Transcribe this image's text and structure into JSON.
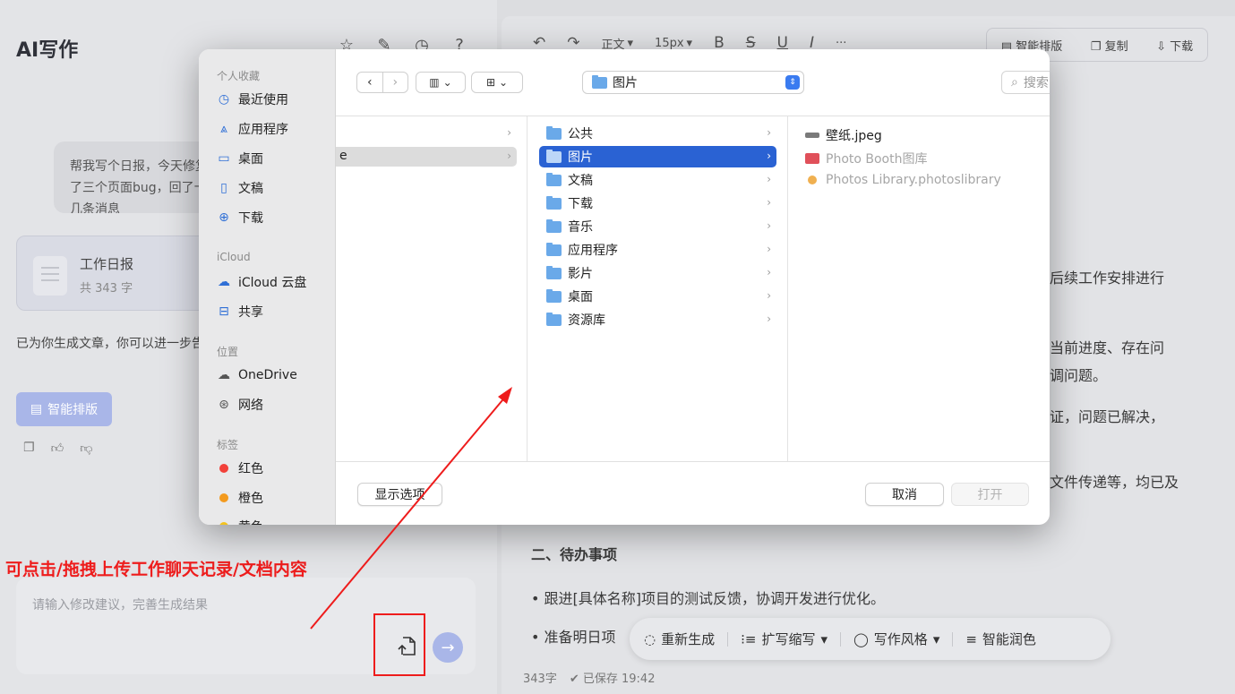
{
  "app": {
    "title": "AI写作",
    "prompt_text": "帮我写个日报，今天修复了三个页面bug，回了十几条消息",
    "doc_card": {
      "title": "工作日报",
      "count": "共 343 字"
    },
    "result_text": "已为你生成文章，你可以进一步告诉我改进的方向。",
    "smart_format_label": "智能排版",
    "annotation": "可点击/拖拽上传工作聊天记录/文档内容",
    "input_placeholder": "请输入修改建议，完善生成结果"
  },
  "editor": {
    "toolbar": {
      "style": "正文",
      "size": "15px",
      "bold": "B",
      "strike": "S",
      "underline": "U",
      "italic": "I",
      "more": "···"
    },
    "actions": {
      "smart_format": "智能排版",
      "copy": "复制",
      "download": "下载"
    },
    "fragments": [
      "后续工作安排进行",
      "当前进度、存在问",
      "调问题。",
      "证，问题已解决，",
      "文件传递等，均已及"
    ],
    "section2": "二、待办事项",
    "bullets": [
      "• 跟进[具体名称]项目的测试反馈，协调开发进行优化。",
      "• 准备明日项"
    ],
    "float_bar": {
      "regen": "重新生成",
      "expand": "扩写缩写",
      "style": "写作风格",
      "polish": "智能润色"
    },
    "status": {
      "words": "343字",
      "saved": "已保存 19:42"
    }
  },
  "dialog": {
    "sidebar": {
      "favorites_title": "个人收藏",
      "favorites": [
        {
          "label": "最近使用",
          "icon": "clock-icon"
        },
        {
          "label": "应用程序",
          "icon": "apps-icon"
        },
        {
          "label": "桌面",
          "icon": "desktop-icon"
        },
        {
          "label": "文稿",
          "icon": "document-icon"
        },
        {
          "label": "下载",
          "icon": "download-icon"
        }
      ],
      "icloud_title": "iCloud",
      "icloud": [
        {
          "label": "iCloud 云盘",
          "icon": "cloud-icon"
        },
        {
          "label": "共享",
          "icon": "shared-folder-icon"
        }
      ],
      "location_title": "位置",
      "locations": [
        {
          "label": "OneDrive",
          "icon": "cloud-icon"
        },
        {
          "label": "网络",
          "icon": "network-icon"
        }
      ],
      "tags_title": "标签",
      "tags": [
        {
          "label": "红色",
          "color": "#f2413a"
        },
        {
          "label": "橙色",
          "color": "#f39a1e"
        },
        {
          "label": "黄色",
          "color": "#f3c31e"
        }
      ]
    },
    "path": "图片",
    "search_placeholder": "搜索",
    "column1": [
      {
        "label": "",
        "selected": false
      },
      {
        "label": "e",
        "selected": true
      }
    ],
    "folders": [
      {
        "label": "公共",
        "selected": false
      },
      {
        "label": "图片",
        "selected": true
      },
      {
        "label": "文稿",
        "selected": false
      },
      {
        "label": "下载",
        "selected": false
      },
      {
        "label": "音乐",
        "selected": false
      },
      {
        "label": "应用程序",
        "selected": false
      },
      {
        "label": "影片",
        "selected": false
      },
      {
        "label": "桌面",
        "selected": false
      },
      {
        "label": "资源库",
        "selected": false
      }
    ],
    "files": [
      {
        "label": "壁纸.jpeg",
        "enabled": true,
        "icon_color": "#7a7a7a"
      },
      {
        "label": "Photo Booth图库",
        "enabled": false,
        "icon_color": "#e0505a"
      },
      {
        "label": "Photos Library.photoslibrary",
        "enabled": false,
        "icon_color": "#f0b050"
      }
    ],
    "buttons": {
      "options": "显示选项",
      "cancel": "取消",
      "open": "打开"
    }
  },
  "colors": {
    "accent": "#2a62d3",
    "annotation": "#ee1c1c",
    "brand": "#a9b6e8"
  }
}
